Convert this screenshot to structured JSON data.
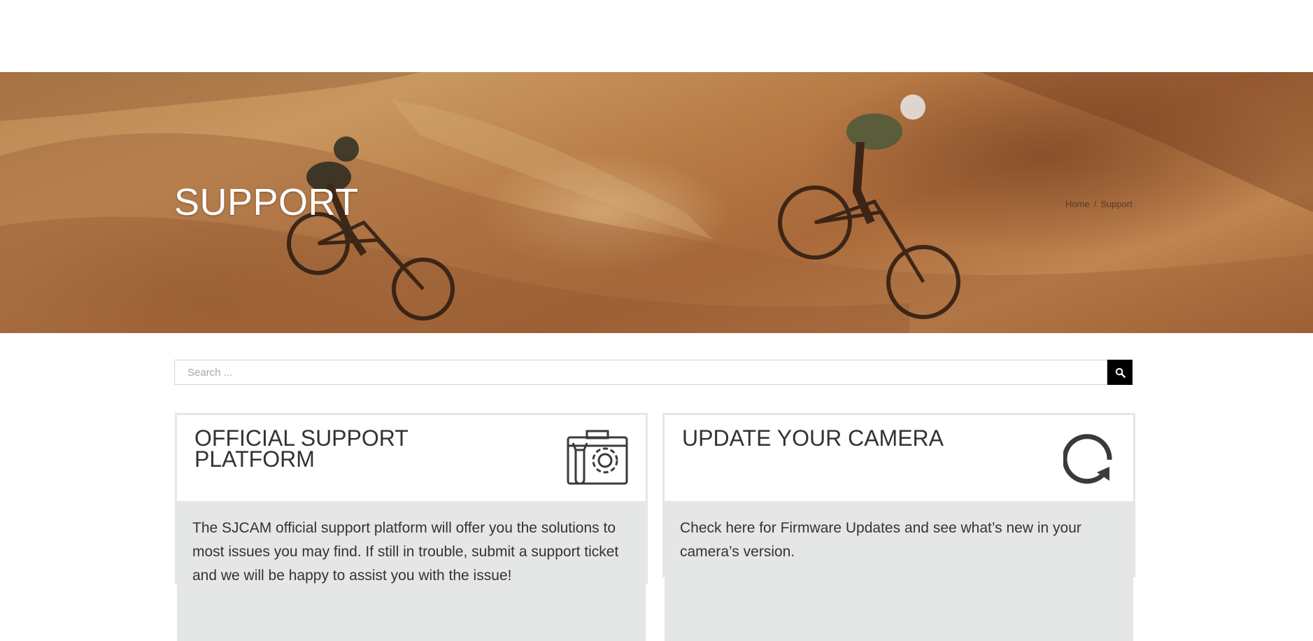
{
  "hero": {
    "title": "SUPPORT",
    "breadcrumb": {
      "home": "Home",
      "separator": "/",
      "current": "Support"
    }
  },
  "search": {
    "placeholder": "Search ...",
    "value": "",
    "button_icon": "search-icon"
  },
  "cards": [
    {
      "title": "OFFICIAL SUPPORT PLATFORM",
      "icon": "toolbox-gear-icon",
      "body": "The SJCAM official support platform will offer you the solutions to most issues you may find. If still in trouble, submit a support ticket and we will be happy to assist you with the issue!"
    },
    {
      "title": "UPDATE YOUR CAMERA",
      "icon": "refresh-icon",
      "body": "Check here for Firmware Updates and see what’s new in your camera’s version."
    }
  ],
  "colors": {
    "card_border": "#e5e7e6",
    "card_body_bg": "#e5e7e6",
    "text": "#333333",
    "search_button": "#000000"
  }
}
